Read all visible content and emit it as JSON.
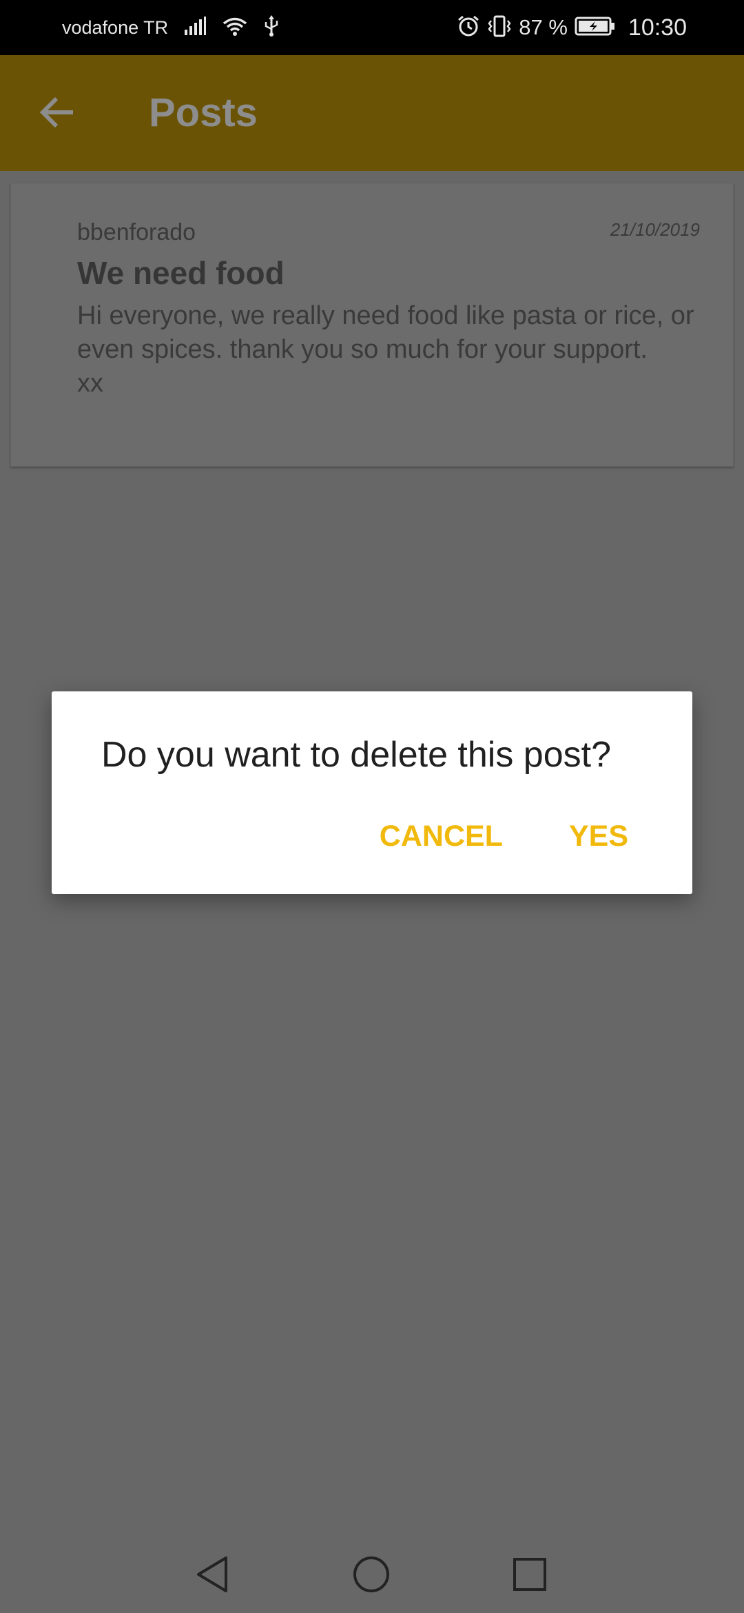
{
  "status_bar": {
    "carrier": "vodafone TR",
    "battery_percent": "87 %",
    "time": "10:30",
    "icons": [
      "signal-icon",
      "wifi-icon",
      "usb-icon",
      "alarm-icon",
      "vibrate-icon",
      "battery-charging-icon"
    ]
  },
  "app_bar": {
    "title": "Posts",
    "back_icon": "arrow-left-icon",
    "color": "#6a5304"
  },
  "post": {
    "author": "bbenforado",
    "date": "21/10/2019",
    "title": "We need food",
    "body": "Hi everyone, we really need food like pasta or rice, or even spices. thank you so much for your support.\nxx"
  },
  "dialog": {
    "message": "Do you want to delete this post?",
    "cancel_label": "CANCEL",
    "confirm_label": "YES",
    "accent_color": "#f0b90b"
  },
  "nav_bar": {
    "icons": [
      "back-triangle-icon",
      "home-circle-icon",
      "recents-square-icon"
    ]
  }
}
